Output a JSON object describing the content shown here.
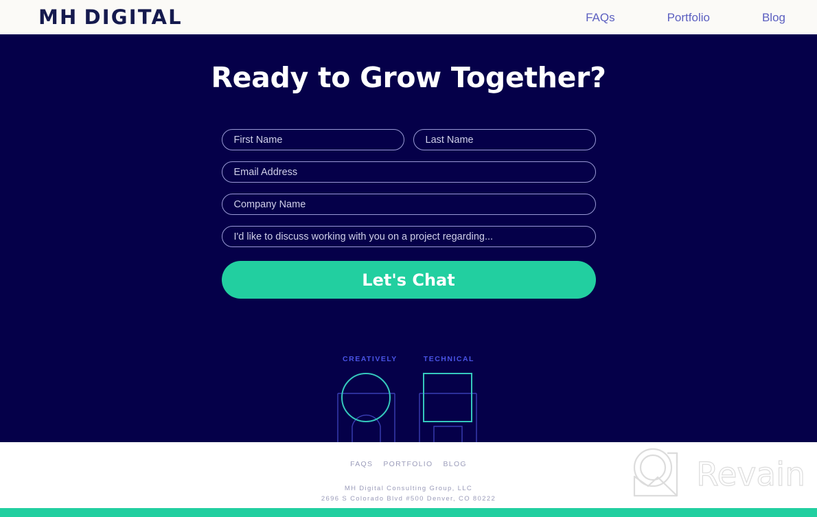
{
  "header": {
    "logo_text": "MH DIGITAL",
    "logo_part_1": "MH",
    "logo_part_2": "DIGITAL",
    "nav": [
      {
        "label": "FAQs",
        "name": "nav-link-faqs"
      },
      {
        "label": "Portfolio",
        "name": "nav-link-portfolio"
      },
      {
        "label": "Blog",
        "name": "nav-link-blog"
      }
    ]
  },
  "hero": {
    "title": "Ready to Grow Together?",
    "background_color": "#050049"
  },
  "form": {
    "first_name": {
      "placeholder": "First Name",
      "value": ""
    },
    "last_name": {
      "placeholder": "Last Name",
      "value": ""
    },
    "email": {
      "placeholder": "Email Address",
      "value": ""
    },
    "company": {
      "placeholder": "Company Name",
      "value": ""
    },
    "message": {
      "placeholder": "I'd like to discuss working with you on a project regarding...",
      "value": ""
    },
    "submit_label": "Let's Chat",
    "submit_color": "#22cfa0",
    "border_color": "#9a9ad6"
  },
  "brand_graphic": {
    "label_left": "CREATIVELY",
    "label_right": "TECHNICAL",
    "label_color": "#4a53e6",
    "letterform_color": "#3a3fb5",
    "accent_color": "#35c9bd"
  },
  "footer": {
    "links": [
      {
        "label": "FAQS",
        "name": "footer-link-faqs"
      },
      {
        "label": "PORTFOLIO",
        "name": "footer-link-portfolio"
      },
      {
        "label": "BLOG",
        "name": "footer-link-blog"
      }
    ],
    "company_name": "MH Digital Consulting Group, LLC",
    "address": "2696 S Colorado Blvd #500 Denver, CO 80222",
    "strip_color": "#22cfa0"
  },
  "watermark": {
    "text": "Revain",
    "icon": "magnifier-photo-icon"
  }
}
